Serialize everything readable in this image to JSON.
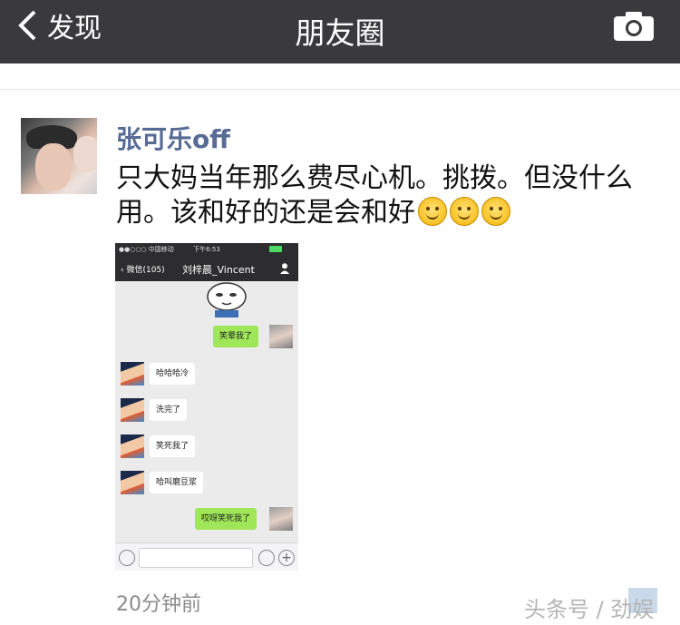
{
  "nav": {
    "back_label": "发现",
    "title": "朋友圈"
  },
  "post": {
    "username": "张可乐off",
    "text": "只大妈当年那么费尽心机。挑拨。但没什么用。该和好的还是会和好",
    "timestamp": "20分钟前"
  },
  "screenshot": {
    "status_carrier": "●●○○○ 中国移动",
    "status_time": "下午6:53",
    "back_label": "微信(105)",
    "chat_title": "刘梓晨_Vincent",
    "messages": [
      {
        "side": "out",
        "text": "笑晕我了"
      },
      {
        "side": "in",
        "text": "哈哈哈冷"
      },
      {
        "side": "in",
        "text": "洗完了"
      },
      {
        "side": "in",
        "text": "笑死我了"
      },
      {
        "side": "in",
        "text": "哈叫磨豆浆"
      },
      {
        "side": "out",
        "text": "哎呀笑死我了"
      }
    ]
  },
  "watermark": "头条号 / 劲娱",
  "colors": {
    "nav_bg": "#3a3a3d",
    "username": "#576b95",
    "bubble_out": "#9fe658"
  }
}
